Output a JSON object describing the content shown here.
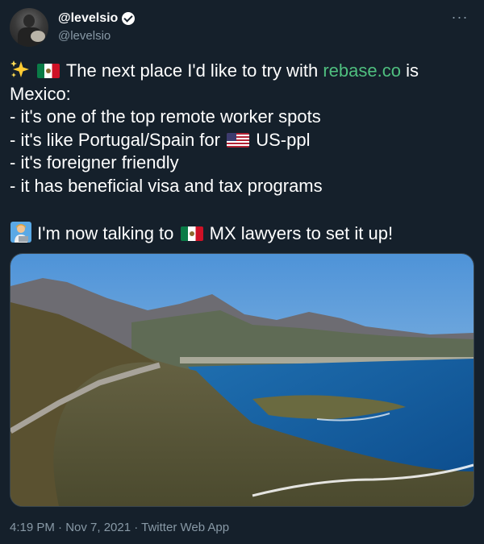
{
  "user": {
    "display_name": "@levelsio",
    "handle": "@levelsio"
  },
  "tweet": {
    "line1_text": "The next place I'd like to try with",
    "link": "rebase.co",
    "line1_tail": "is",
    "line2": "Mexico:",
    "line3": "- it's one of the top remote worker spots",
    "line4_before": "- it's like Portugal/Spain for",
    "line4_after": "US-ppl",
    "line5": "- it's foreigner friendly",
    "line6": "- it has beneficial visa and tax programs",
    "line7_before": "I'm now talking to",
    "line7_after": "MX lawyers to set it up!"
  },
  "footer": {
    "timestamp": "4:19 PM · Nov 7, 2021 · Twitter Web App"
  },
  "icons": {
    "sparkles": "sparkles-icon",
    "mexico_flag": "mexico-flag-icon",
    "us_flag": "us-flag-icon",
    "person": "person-laptop-icon",
    "verified": "verified-badge-icon",
    "more": "more-options-icon"
  },
  "colors": {
    "background": "#15202b",
    "link": "#4fbf7f",
    "secondary_text": "#8899a6"
  }
}
